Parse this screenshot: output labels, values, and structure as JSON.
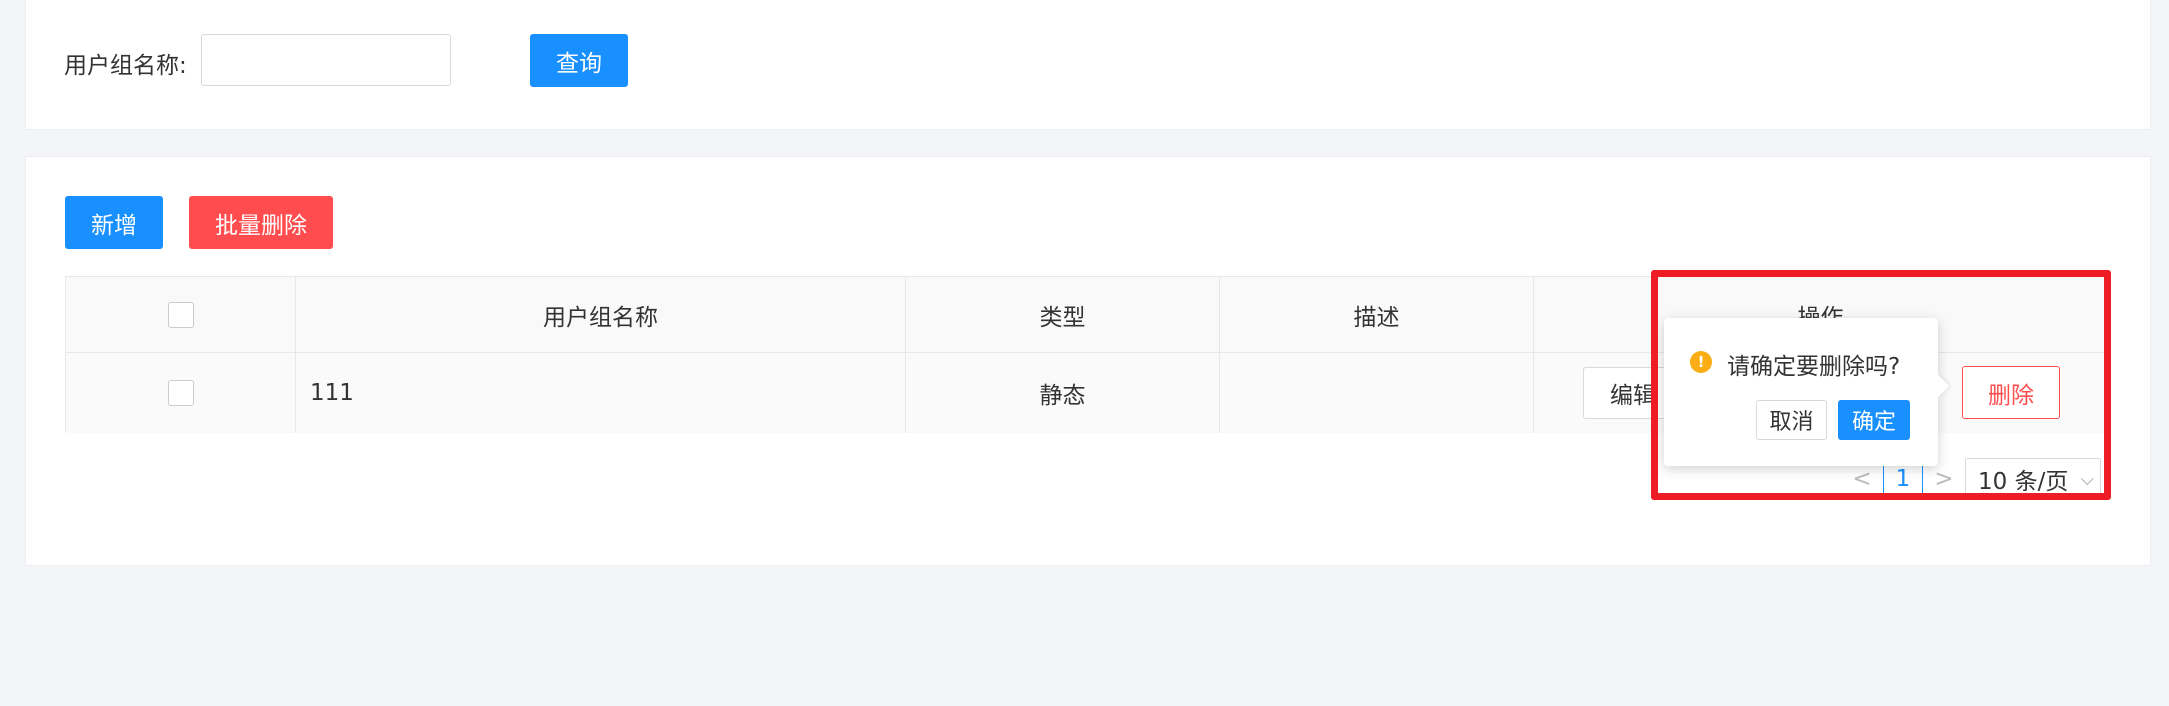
{
  "search": {
    "label": "用户组名称:",
    "input_value": "",
    "query_button": "查询"
  },
  "toolbar": {
    "add_button": "新增",
    "batch_delete_button": "批量删除"
  },
  "table": {
    "columns": [
      "",
      "用户组名称",
      "类型",
      "描述",
      "操作"
    ],
    "rows": [
      {
        "name": "111",
        "type": "静态",
        "description": "",
        "edit": "编辑",
        "delete": "删除"
      }
    ]
  },
  "pagination": {
    "prev": "<",
    "current_page": "1",
    "next": ">",
    "page_size": "10 条/页"
  },
  "popconfirm": {
    "message": "请确定要删除吗?",
    "cancel": "取消",
    "confirm": "确定"
  },
  "colors": {
    "primary": "#1890ff",
    "danger": "#ff4d4f",
    "warning": "#faad14",
    "highlight": "#ee1c25"
  }
}
